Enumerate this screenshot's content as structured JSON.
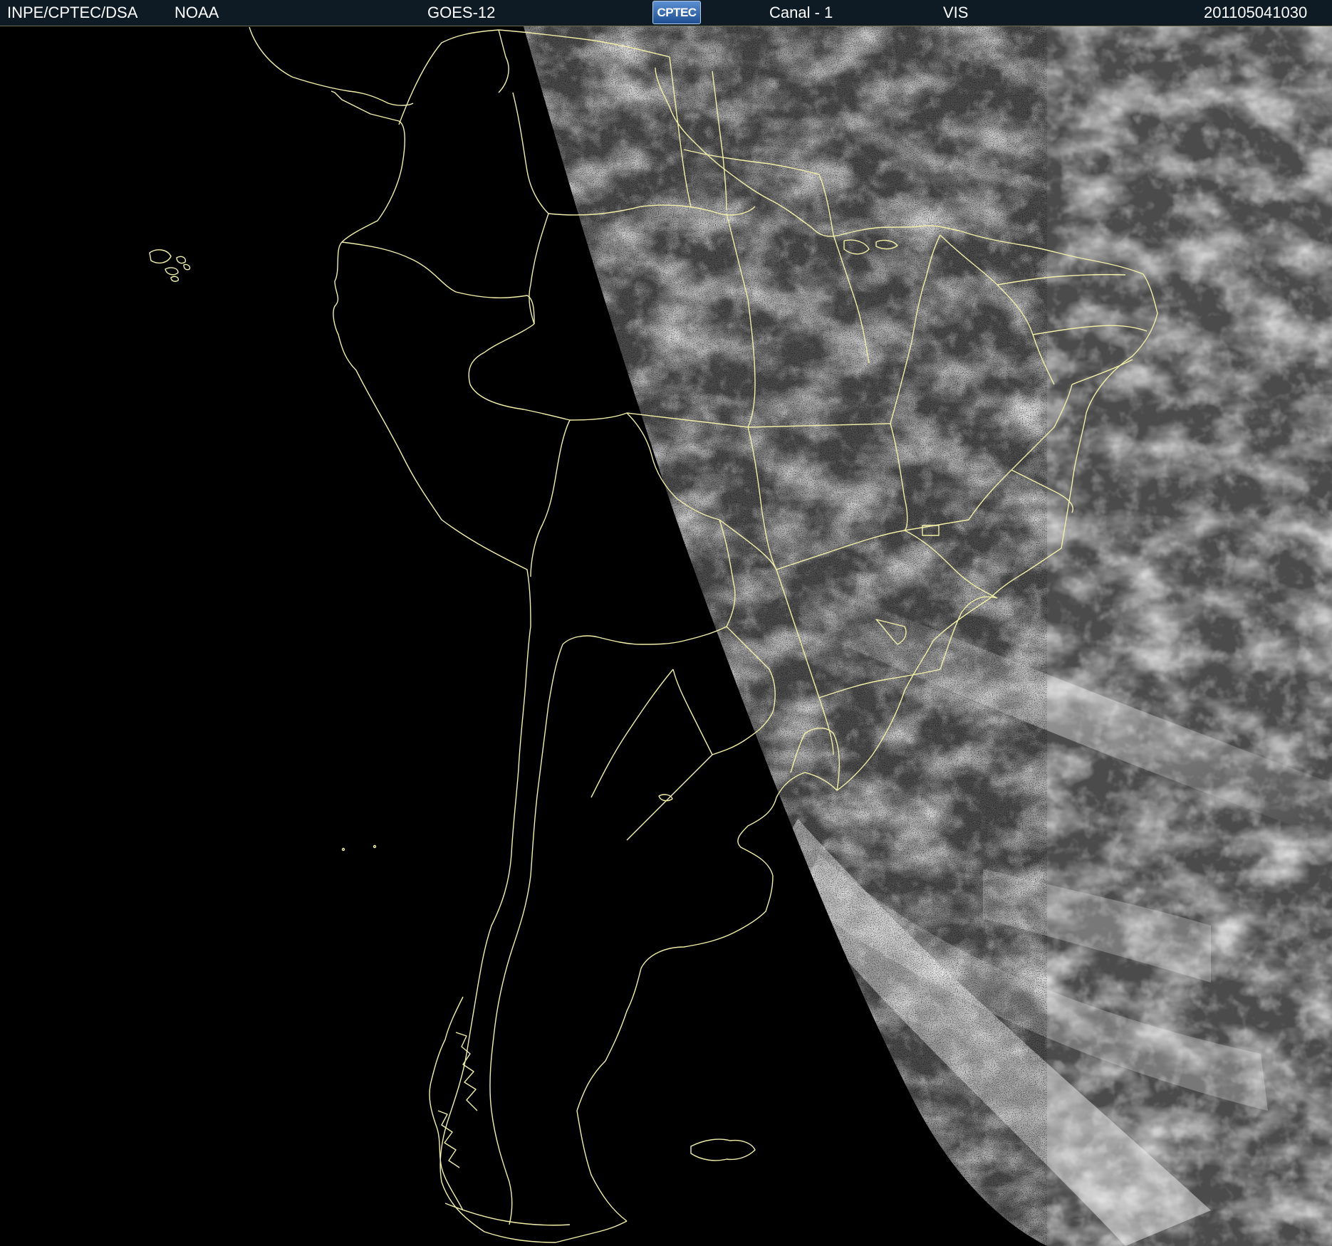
{
  "header": {
    "institution": "INPE/CPTEC/DSA",
    "agency": "NOAA",
    "satellite": "GOES-12",
    "logo": "CPTEC",
    "channel": "Canal - 1",
    "band": "VIS",
    "timestamp": "201105041030"
  },
  "colors": {
    "header_bg": "#0e1b25",
    "border_lines": "#f2f0a8",
    "night_side": "#000000",
    "ocean_dark": "#3a3a3a",
    "cloud_bright": "#e6e6e6"
  },
  "map": {
    "projection": "satellite visible image, terminator (day/night boundary) crossing South America",
    "overlay": "country and state borders, coastlines in pale yellow"
  }
}
